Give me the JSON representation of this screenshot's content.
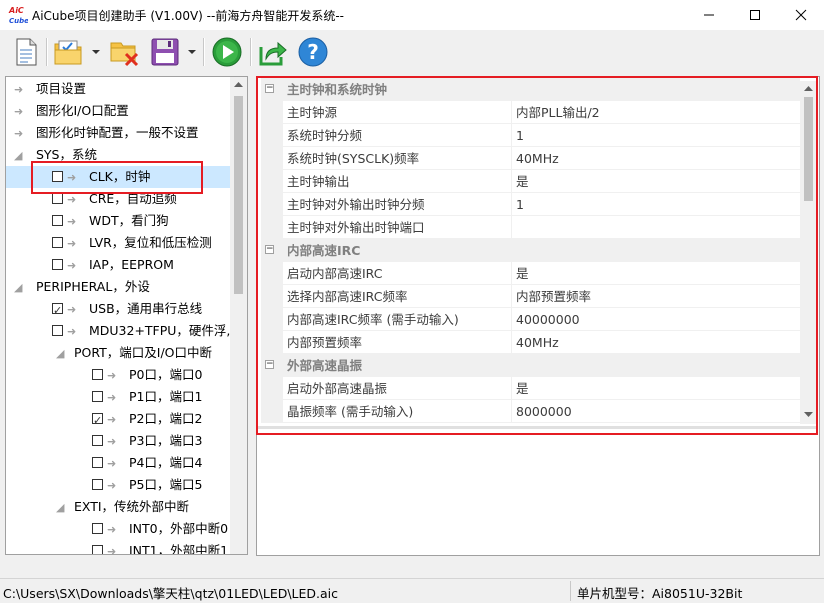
{
  "window": {
    "title": "AiCube项目创建助手 (V1.00V) --前海方舟智能开发系统--",
    "logo_text": "AiC"
  },
  "toolbar": {
    "buttons": [
      {
        "name": "new-file-icon"
      },
      {
        "name": "open-folder-icon"
      },
      {
        "name": "delete-folder-icon"
      },
      {
        "name": "save-icon"
      },
      {
        "name": "run-icon"
      },
      {
        "name": "export-icon"
      },
      {
        "name": "help-icon"
      }
    ]
  },
  "tree": {
    "items": [
      {
        "label": "项目设置"
      },
      {
        "label": "图形化I/O口配置"
      },
      {
        "label": "图形化时钟配置，一般不设置"
      },
      {
        "label": "SYS，系统"
      },
      {
        "label": "CLK，时钟"
      },
      {
        "label": "CRE，自动追频"
      },
      {
        "label": "WDT，看门狗"
      },
      {
        "label": "LVR，复位和低压检测"
      },
      {
        "label": "IAP，EEPROM"
      },
      {
        "label": "PERIPHERAL，外设"
      },
      {
        "label": "USB，通用串行总线"
      },
      {
        "label": "MDU32+TFPU，硬件浮,"
      },
      {
        "label": "PORT，端口及I/O口中断"
      },
      {
        "label": "P0口，端口0"
      },
      {
        "label": "P1口，端口1"
      },
      {
        "label": "P2口，端口2"
      },
      {
        "label": "P3口，端口3"
      },
      {
        "label": "P4口，端口4"
      },
      {
        "label": "P5口，端口5"
      },
      {
        "label": "EXTI，传统外部中断"
      },
      {
        "label": "INT0，外部中断0"
      },
      {
        "label": "INT1，外部中断1"
      }
    ]
  },
  "properties": {
    "categories": [
      {
        "title": "主时钟和系统时钟",
        "rows": [
          {
            "name": "主时钟源",
            "value": "内部PLL输出/2"
          },
          {
            "name": "系统时钟分频",
            "value": "1"
          },
          {
            "name": "系统时钟(SYSCLK)频率",
            "value": "40MHz"
          },
          {
            "name": "主时钟输出",
            "value": "是"
          },
          {
            "name": "主时钟对外输出时钟分频",
            "value": "1"
          },
          {
            "name": "主时钟对外输出时钟端口",
            "value": ""
          }
        ]
      },
      {
        "title": "内部高速IRC",
        "rows": [
          {
            "name": "启动内部高速IRC",
            "value": "是"
          },
          {
            "name": "选择内部高速IRC频率",
            "value": "内部预置频率"
          },
          {
            "name": "内部高速IRC频率 (需手动输入)",
            "value": "40000000"
          },
          {
            "name": "内部预置频率",
            "value": "40MHz"
          }
        ]
      },
      {
        "title": "外部高速晶振",
        "rows": [
          {
            "name": "启动外部高速晶振",
            "value": "是"
          },
          {
            "name": "晶振频率 (需手动输入)",
            "value": "8000000"
          }
        ]
      }
    ]
  },
  "status": {
    "path": "C:\\Users\\SX\\Downloads\\擎天柱\\qtz\\01LED\\LED\\LED.aic",
    "chip_label": "单片机型号：Ai8051U-32Bit"
  },
  "colors": {
    "highlight_box": "#e51c23",
    "selection": "#cce8ff"
  }
}
